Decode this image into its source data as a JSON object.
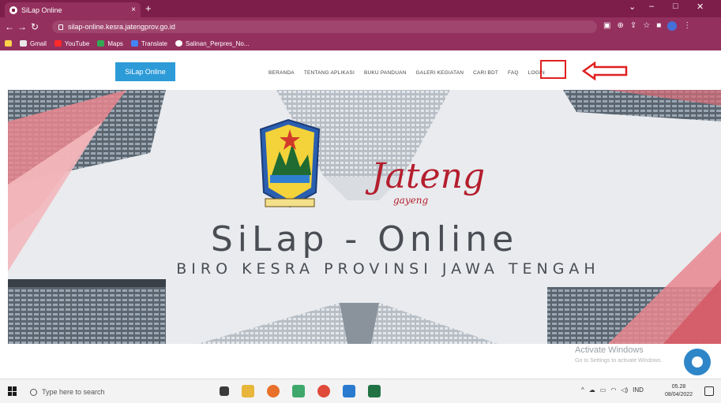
{
  "browser": {
    "tab_title": "SiLap Online",
    "tab_close": "×",
    "new_tab": "+",
    "url": "silap-online.kesra.jatengprov.go.id",
    "window_controls": [
      "⌄",
      "–",
      "□",
      "✕"
    ],
    "bookmarks": [
      {
        "label": "Gmail",
        "color": "#e8e8e8"
      },
      {
        "label": "YouTube",
        "color": "#ff2a2a"
      },
      {
        "label": "Maps",
        "color": "#34a853"
      },
      {
        "label": "Translate",
        "color": "#4285f4"
      },
      {
        "label": "Salinan_Perpres_No...",
        "color": "#ffffff"
      }
    ]
  },
  "site": {
    "brand": "SiLap Online",
    "menu": [
      "BERANDA",
      "TENTANG APLIKASI",
      "BUKU PANDUAN",
      "GALERI KEGIATAN",
      "CARI BDT",
      "FAQ",
      "LOGIN"
    ],
    "hero": {
      "logo_text": "Jateng",
      "logo_sub": "gayeng",
      "title": "SiLap - Online",
      "subtitle": "BIRO KESRA PROVINSI JAWA TENGAH"
    },
    "annotation_color": "#e02020",
    "watermark_title": "Activate Windows",
    "watermark_sub": "Go to Settings to activate Windows."
  },
  "taskbar": {
    "search_placeholder": "Type here to search",
    "tray_lang": "IND",
    "time": "05.28",
    "date": "08/04/2022"
  }
}
